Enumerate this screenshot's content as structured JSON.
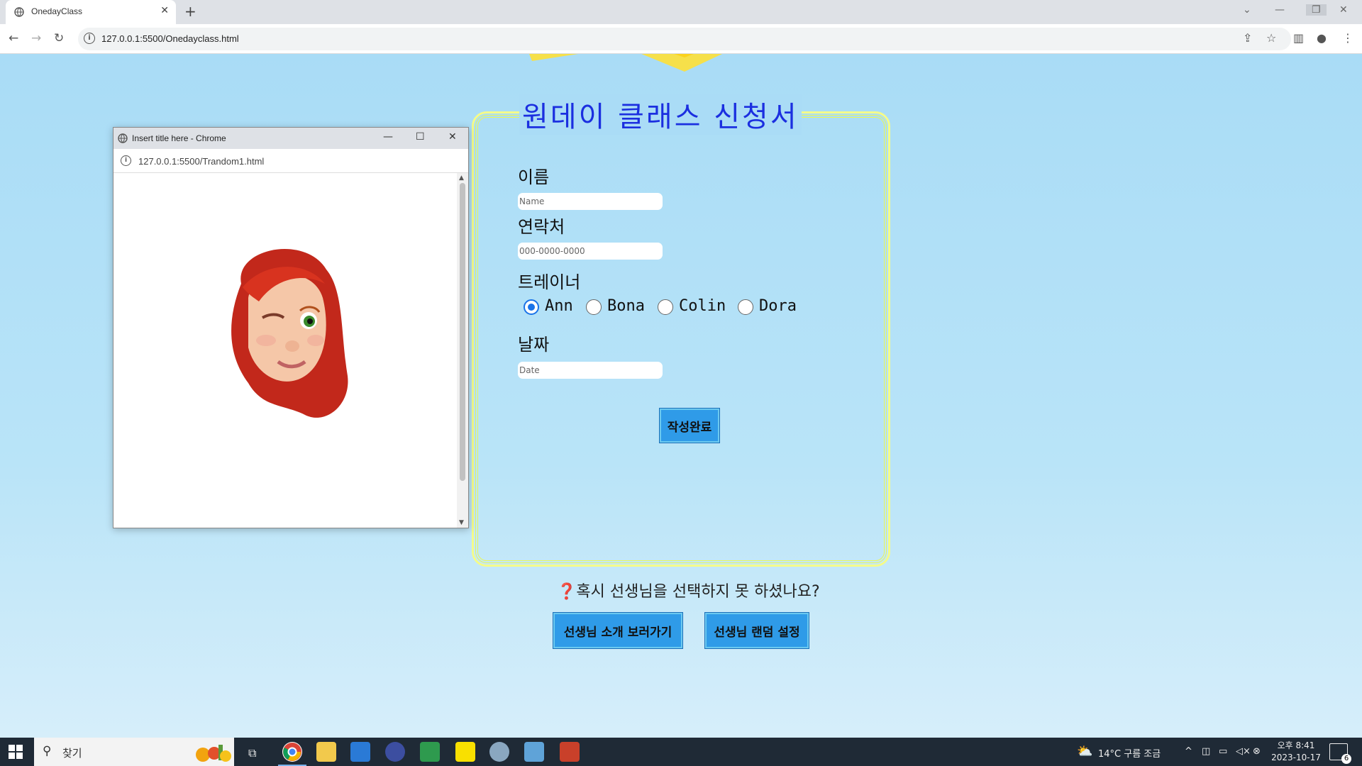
{
  "browser": {
    "tab_title": "OnedayClass",
    "new_tab": "+",
    "url": "127.0.0.1:5500/Onedayclass.html"
  },
  "popup": {
    "title": "Insert title here - Chrome",
    "url": "127.0.0.1:5500/Trandom1.html"
  },
  "form": {
    "title": "원데이 클래스 신청서",
    "name_label": "이름",
    "name_placeholder": "Name",
    "contact_label": "연락처",
    "contact_placeholder": "000-0000-0000",
    "trainer_label": "트레이너",
    "trainers": [
      "Ann",
      "Bona",
      "Colin",
      "Dora"
    ],
    "selected_trainer": "Ann",
    "date_label": "날짜",
    "date_placeholder": "Date",
    "submit_label": "작성완료"
  },
  "bottom": {
    "question_mark": "❓",
    "question": "혹시 선생님을 선택하지 못 하셨나요?",
    "btn_intro": "선생님 소개 보러가기",
    "btn_random": "선생님 랜덤 설정"
  },
  "taskbar": {
    "search_label": "찾기",
    "weather": "14°C 구름 조금",
    "time": "오후 8:41",
    "date": "2023-10-17",
    "notif_count": "6"
  },
  "colors": {
    "title_blue": "#1b2fe0",
    "button_blue": "#2f9be8",
    "frame_yellow": "#e9f75a",
    "bg_sky": "#a9dcf6"
  }
}
